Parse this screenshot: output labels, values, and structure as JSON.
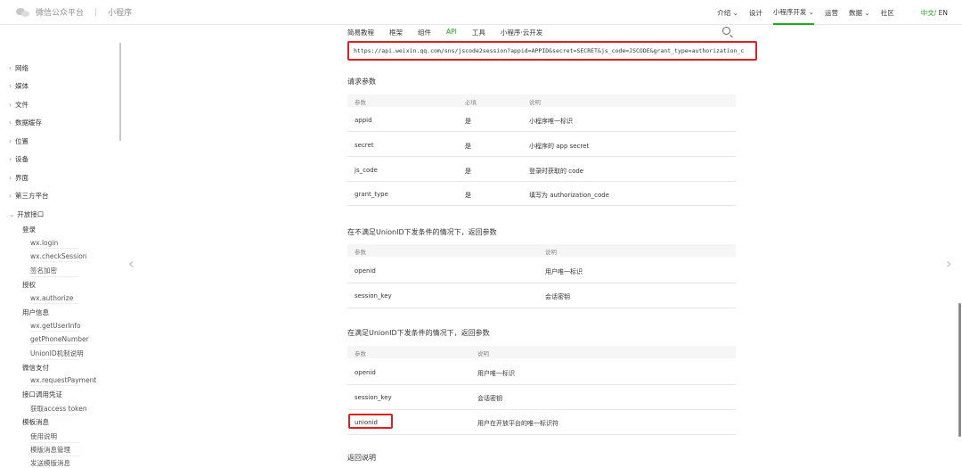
{
  "header": {
    "site": "微信公众平台",
    "section": "小程序",
    "nav": [
      "介绍",
      "设计",
      "小程序开发",
      "运营",
      "数据",
      "社区"
    ],
    "nav_dropdown": [
      "介绍",
      "小程序开发",
      "数据"
    ],
    "lang_zh": "中文",
    "lang_sep": "/",
    "lang_en": "EN"
  },
  "subnav": {
    "items": [
      "简易教程",
      "框架",
      "组件",
      "API",
      "工具",
      "小程序·云开发"
    ],
    "active": "API"
  },
  "sidebar": {
    "top": [
      "网络",
      "媒体",
      "文件",
      "数据缓存",
      "位置",
      "设备",
      "界面",
      "第三方平台"
    ],
    "open": "开放接口",
    "groups": [
      {
        "label": "登录",
        "items": [
          "wx.login",
          "wx.checkSession",
          "签名加密"
        ]
      },
      {
        "label": "授权",
        "items": [
          "wx.authorize"
        ]
      },
      {
        "label": "用户信息",
        "items": [
          "wx.getUserInfo",
          "getPhoneNumber",
          "UnionID机制说明"
        ]
      },
      {
        "label": "微信支付",
        "items": [
          "wx.requestPayment"
        ]
      },
      {
        "label": "接口调用凭证",
        "items": [
          "获取access token"
        ]
      },
      {
        "label": "模板消息",
        "items": [
          "使用说明",
          "模版消息管理",
          "发送模版消息"
        ]
      }
    ]
  },
  "url": "https://api.weixin.qq.com/sns/jscode2session?appid=APPID&secret=SECRET&js_code=JSCODE&grant_type=authorization_c",
  "request": {
    "title": "请求参数",
    "headers": [
      "参数",
      "必填",
      "说明"
    ],
    "rows": [
      [
        "appid",
        "是",
        "小程序唯一标识"
      ],
      [
        "secret",
        "是",
        "小程序的 app secret"
      ],
      [
        "js_code",
        "是",
        "登录时获取的 code"
      ],
      [
        "grant_type",
        "是",
        "填写为 authorization_code"
      ]
    ]
  },
  "no_union": {
    "title": "在不满足UnionID下发条件的情况下，返回参数",
    "headers": [
      "参数",
      "说明"
    ],
    "rows": [
      [
        "openid",
        "用户唯一标识"
      ],
      [
        "session_key",
        "会话密钥"
      ]
    ]
  },
  "with_union": {
    "title": "在满足UnionID下发条件的情况下，返回参数",
    "headers": [
      "参数",
      "说明"
    ],
    "rows": [
      [
        "openid",
        "用户唯一标识"
      ],
      [
        "session_key",
        "会话密钥"
      ],
      [
        "unionid",
        "用户在开放平台的唯一标识符"
      ]
    ]
  },
  "return_title": "返回说明",
  "colors": {
    "accent": "#1aad19",
    "highlight": "#e02020"
  }
}
